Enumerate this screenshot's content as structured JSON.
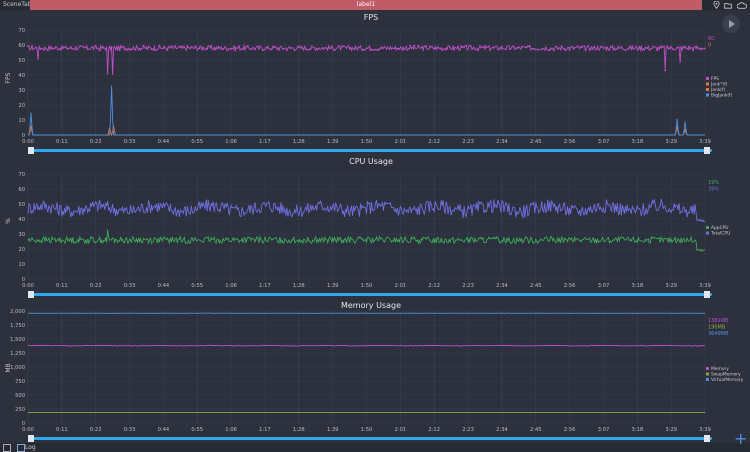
{
  "topbar": {
    "scene_tab": "SceneTab",
    "label_tab": "label1"
  },
  "icons": [
    "location-icon",
    "folder-icon",
    "cloud-icon",
    "play-icon",
    "log-toggle-icon",
    "add-icon"
  ],
  "bottombar": {
    "log_label": "Log"
  },
  "colors": {
    "magenta": "#c04ec8",
    "orange": "#e07a3c",
    "blue": "#4f8fe0",
    "green": "#3fa85c",
    "purple": "#6f6fe0",
    "scrollbar": "#35a6e6",
    "grid": "#3a4050",
    "text": "#d6d8de"
  },
  "time_ticks": [
    "0:00",
    "0:11",
    "0:22",
    "0:33",
    "0:44",
    "0:55",
    "1:06",
    "1:17",
    "1:28",
    "1:39",
    "1:50",
    "2:01",
    "2:12",
    "2:23",
    "2:34",
    "2:45",
    "2:56",
    "3:07",
    "3:18",
    "3:29",
    "3:39"
  ],
  "chart_data": [
    {
      "type": "line",
      "title": "FPS",
      "ylabel": "FPS",
      "ylim": [
        0,
        70
      ],
      "yticks": [
        "0",
        "10",
        "20",
        "30",
        "40",
        "50",
        "60",
        "70"
      ],
      "legend": [
        "FPS",
        "Jank*(f)",
        "Jank(f)",
        "BigJank(f)"
      ],
      "legend_position": "right",
      "current_values": [
        "60",
        "0"
      ],
      "series": [
        {
          "name": "FPS",
          "color": "#c04ec8",
          "base": 58,
          "spread": 1.6,
          "dots": true,
          "spikes": [
            [
              10,
              50
            ],
            [
              80,
              41
            ],
            [
              85,
              40
            ],
            [
              640,
              43
            ],
            [
              655,
              48
            ],
            [
              688,
              52
            ]
          ]
        },
        {
          "name": "Jank(f)",
          "color": "#e07a3c",
          "base": 0,
          "spread": 0,
          "spikes": [
            [
              3,
              6
            ],
            [
              82,
              5
            ],
            [
              86,
              6
            ],
            [
              652,
              6
            ],
            [
              660,
              4
            ],
            [
              688,
              5
            ]
          ]
        },
        {
          "name": "BigJank(f)",
          "color": "#4f8fe0",
          "base": 0,
          "spread": 0,
          "spikes": [
            [
              3,
              15
            ],
            [
              84,
              33
            ],
            [
              652,
              11
            ],
            [
              660,
              9
            ],
            [
              688,
              12
            ]
          ]
        }
      ]
    },
    {
      "type": "line",
      "title": "CPU Usage",
      "ylabel": "%",
      "ylim": [
        0,
        70
      ],
      "yticks": [
        "0",
        "10",
        "20",
        "30",
        "40",
        "50",
        "60",
        "70"
      ],
      "legend": [
        "AppCPU",
        "TotalCPU"
      ],
      "legend_position": "right",
      "current_values": [
        "19%",
        "39%"
      ],
      "series": [
        {
          "name": "TotalCPU",
          "color": "#6f6fe0",
          "base": 47,
          "spread": 4.5,
          "dots": false,
          "spikes": [],
          "end": 39
        },
        {
          "name": "AppCPU",
          "color": "#3fa85c",
          "base": 26,
          "spread": 2.2,
          "dots": false,
          "spikes": [
            [
              80,
              33
            ]
          ],
          "end": 19
        }
      ]
    },
    {
      "type": "line",
      "title": "Memory Usage",
      "ylabel": "MB",
      "ylim": [
        0,
        2000
      ],
      "yticks": [
        "0",
        "250",
        "500",
        "750",
        "1,000",
        "1,250",
        "1,500",
        "1,750",
        "2,000"
      ],
      "legend": [
        "Memory",
        "SwapMemory",
        "VirtualMemory"
      ],
      "legend_position": "right",
      "current_values": [
        "1381MB",
        "190MB",
        "3649MB"
      ],
      "series": [
        {
          "name": "VirtualMemory",
          "color": "#4f8fe0",
          "base": 1960,
          "spread": 2,
          "dots": false,
          "spikes": []
        },
        {
          "name": "Memory",
          "color": "#c04ec8",
          "base": 1381,
          "spread": 6,
          "dots": false,
          "spikes": []
        },
        {
          "name": "SwapMemory",
          "color": "#8fa83f",
          "base": 190,
          "spread": 0,
          "dots": false,
          "spikes": []
        }
      ]
    }
  ]
}
